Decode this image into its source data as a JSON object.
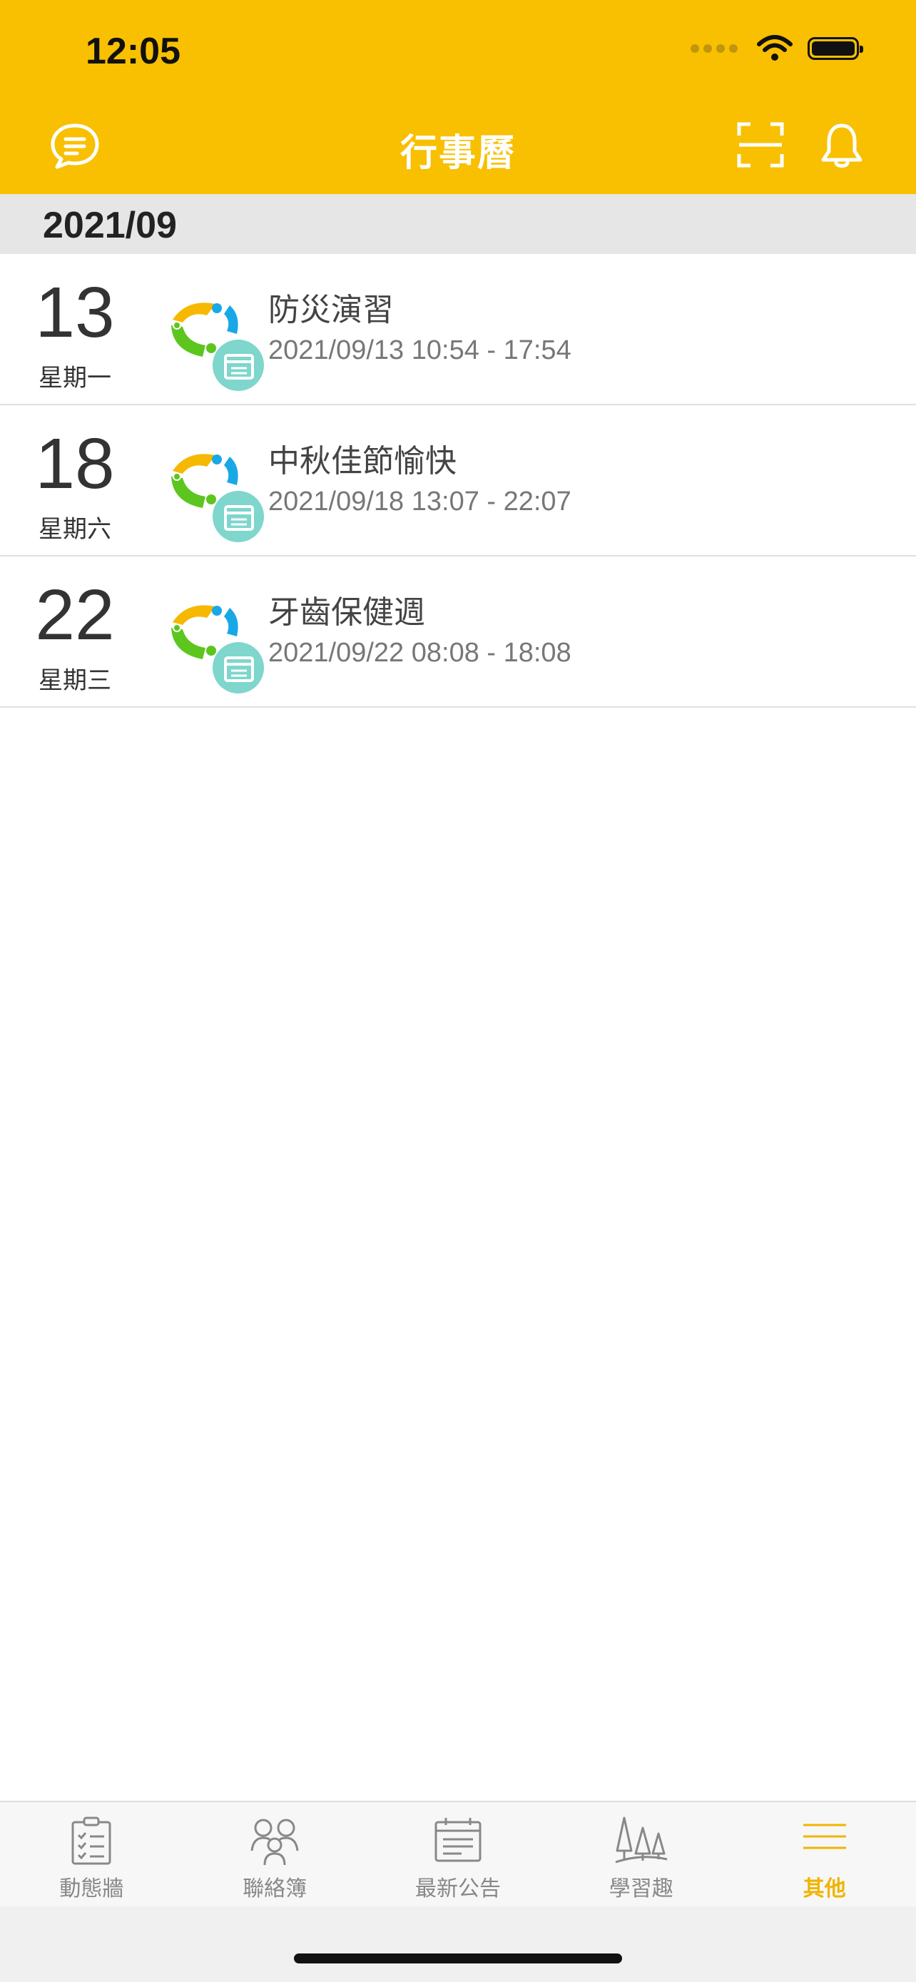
{
  "status_bar": {
    "time": "12:05"
  },
  "header": {
    "title": "行事曆",
    "left_icon": "chat-bubble-icon",
    "right_icons": [
      "scan-icon",
      "bell-icon"
    ],
    "color": "#F8C000"
  },
  "month": {
    "label": "2021/09"
  },
  "events": [
    {
      "day": "13",
      "weekday": "星期一",
      "title": "防災演習",
      "time": "2021/09/13 10:54 - 17:54"
    },
    {
      "day": "18",
      "weekday": "星期六",
      "title": "中秋佳節愉快",
      "time": "2021/09/18 13:07 - 22:07"
    },
    {
      "day": "22",
      "weekday": "星期三",
      "title": "牙齒保健週",
      "time": "2021/09/22 08:08 - 18:08"
    }
  ],
  "tabbar": {
    "active_color": "#F0B400",
    "tabs": [
      {
        "label": "動態牆",
        "icon": "clipboard-checklist-icon"
      },
      {
        "label": "聯絡簿",
        "icon": "family-group-icon"
      },
      {
        "label": "最新公告",
        "icon": "calendar-notice-icon"
      },
      {
        "label": "學習趣",
        "icon": "trees-icon"
      },
      {
        "label": "其他",
        "icon": "menu-lines-icon",
        "active": true
      }
    ]
  }
}
